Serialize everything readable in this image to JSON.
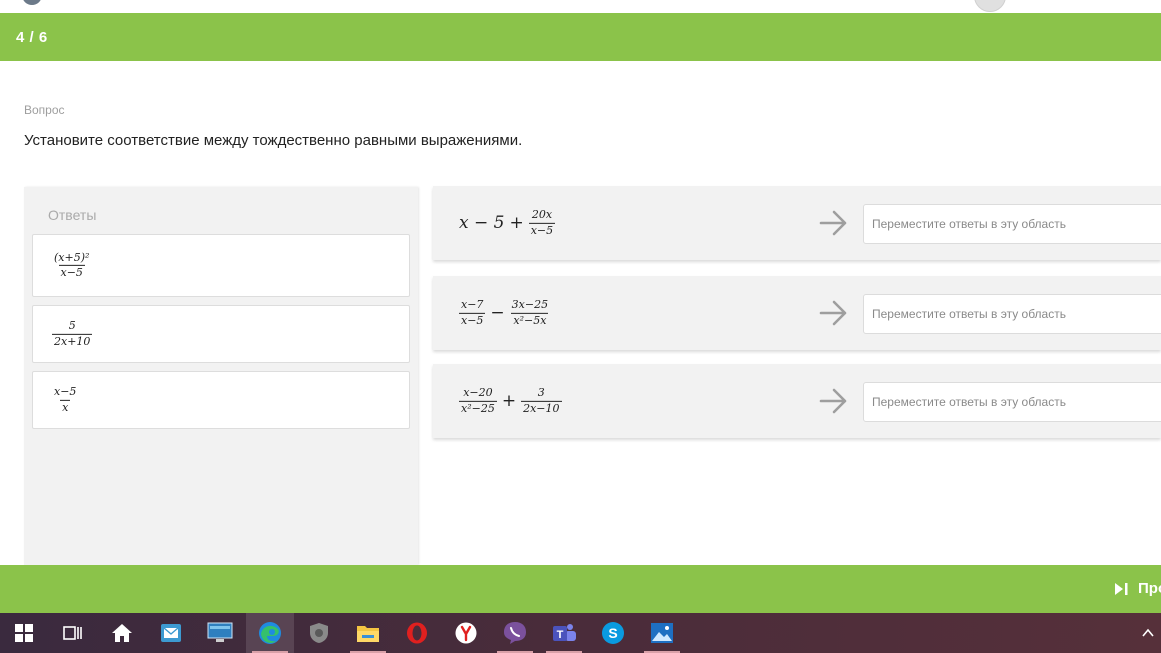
{
  "header": {
    "progress": "4 / 6"
  },
  "question": {
    "label": "Вопрос",
    "text": "Установите соответствие между тождественно равными выражениями."
  },
  "answers": {
    "title": "Ответы",
    "items": [
      {
        "num": "(x+5)²",
        "den": "x−5"
      },
      {
        "num": "5",
        "den": "2x+10"
      },
      {
        "num": "x−5",
        "den": "x"
      }
    ]
  },
  "rows": [
    {
      "lead": "x − 5",
      "op": "+",
      "f_num": "20x",
      "f_den": "x−5",
      "placeholder": "Переместите ответы в эту область"
    },
    {
      "a_num": "x−7",
      "a_den": "x−5",
      "op": "−",
      "b_num": "3x−25",
      "b_den": "x²−5x",
      "placeholder": "Переместите ответы в эту область"
    },
    {
      "a_num": "x−20",
      "a_den": "x²−25",
      "op": "+",
      "b_num": "3",
      "b_den": "2x−10",
      "placeholder": "Переместите ответы в эту область"
    }
  ],
  "footer": {
    "skip_label": "Про"
  },
  "colors": {
    "accent_green": "#8bc34a",
    "panel_gray": "#f2f2f2"
  },
  "taskbar": {
    "icons": [
      "windows-start-icon",
      "task-view-icon",
      "home-icon",
      "mail-icon",
      "monitor-app-icon",
      "edge-icon",
      "security-shield-icon",
      "file-explorer-icon",
      "opera-icon",
      "yandex-icon",
      "viber-icon",
      "teams-icon",
      "skype-icon",
      "photos-icon",
      "chevron-up-icon"
    ]
  }
}
